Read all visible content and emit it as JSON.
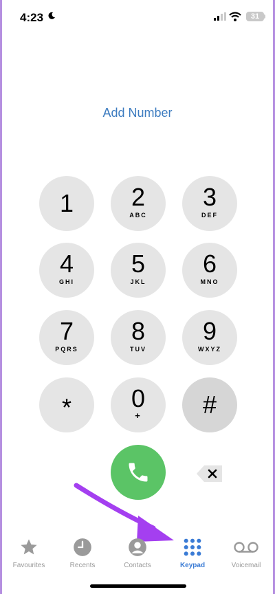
{
  "status": {
    "time": "4:23",
    "battery": "31"
  },
  "add_number_label": "Add Number",
  "keys": [
    {
      "digit": "1",
      "letters": ""
    },
    {
      "digit": "2",
      "letters": "ABC"
    },
    {
      "digit": "3",
      "letters": "DEF"
    },
    {
      "digit": "4",
      "letters": "GHI"
    },
    {
      "digit": "5",
      "letters": "JKL"
    },
    {
      "digit": "6",
      "letters": "MNO"
    },
    {
      "digit": "7",
      "letters": "PQRS"
    },
    {
      "digit": "8",
      "letters": "TUV"
    },
    {
      "digit": "9",
      "letters": "WXYZ"
    },
    {
      "digit": "*",
      "letters": ""
    },
    {
      "digit": "0",
      "letters": "+"
    },
    {
      "digit": "#",
      "letters": ""
    }
  ],
  "tabs": [
    {
      "label": "Favourites",
      "icon": "star-icon"
    },
    {
      "label": "Recents",
      "icon": "clock-icon"
    },
    {
      "label": "Contacts",
      "icon": "person-icon"
    },
    {
      "label": "Keypad",
      "icon": "keypad-icon",
      "active": true
    },
    {
      "label": "Voicemail",
      "icon": "voicemail-icon"
    }
  ],
  "colors": {
    "accent": "#3a7bd5",
    "call": "#5bc466",
    "arrow": "#a43ff0"
  }
}
